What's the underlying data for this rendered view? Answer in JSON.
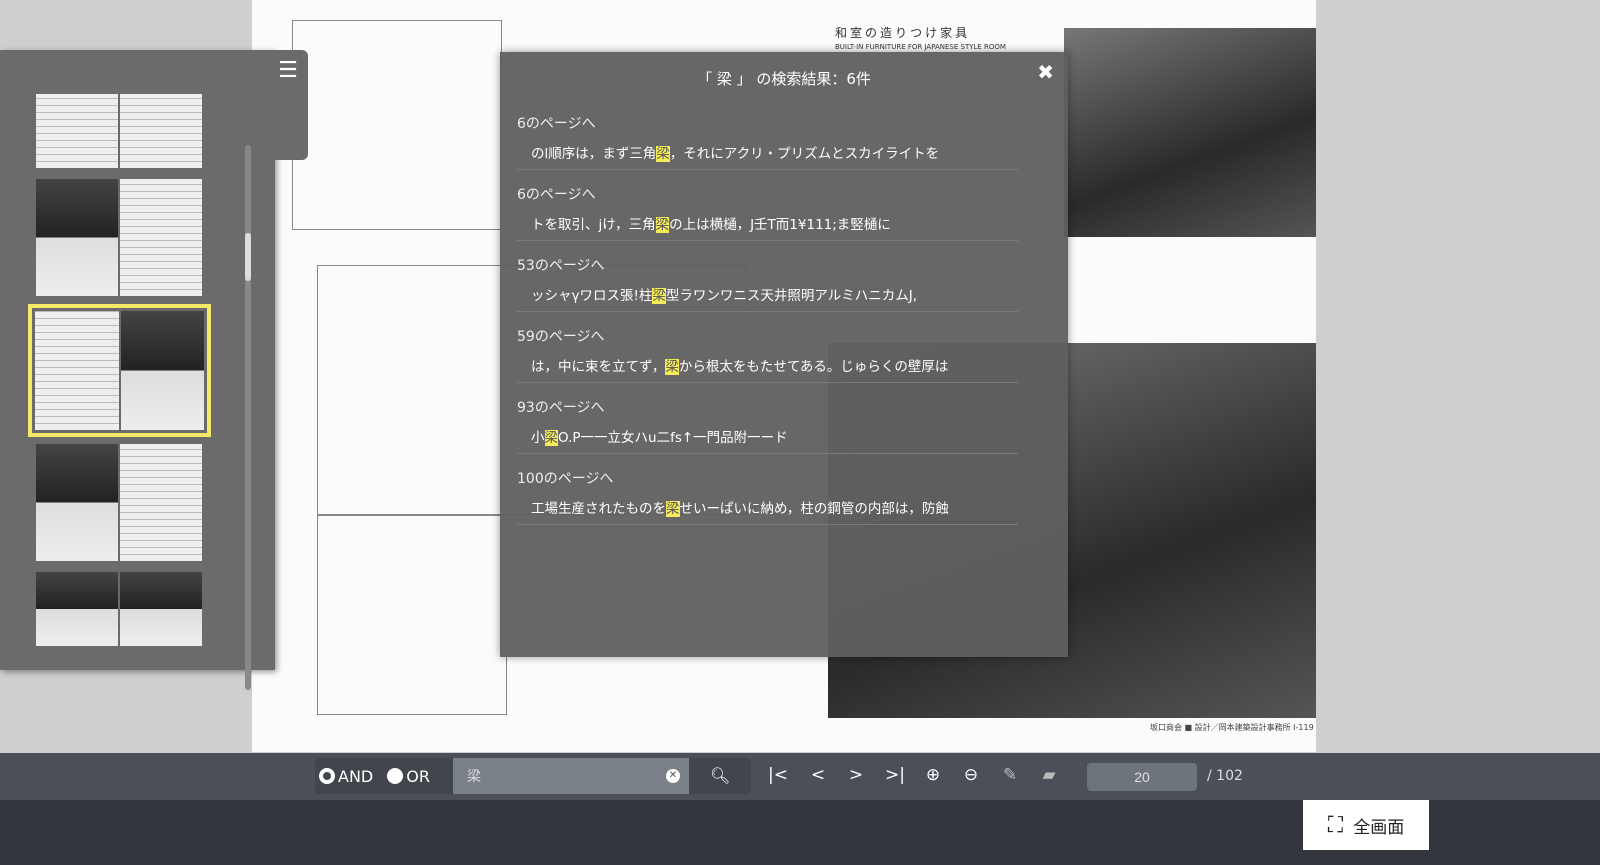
{
  "document": {
    "title_jp": "和室の造りつけ家具",
    "title_en": "BUILT-IN FURNITURE FOR JAPANESE STYLE ROOM",
    "footer": "坂口商会 ■ 設計／岡本建築設計事務所 I-119"
  },
  "thumbnails": [
    {
      "selected": false
    },
    {
      "selected": false
    },
    {
      "selected": true
    },
    {
      "selected": false
    },
    {
      "selected": false
    }
  ],
  "search_modal": {
    "title": "「 梁 」 の検索結果：6件",
    "close_icon": "close-icon",
    "results": [
      {
        "page": "6のページへ",
        "before": "のl順序は，まず三角",
        "hit": "梁",
        "after": "，それにアクリ・プリズムとスカイライトを"
      },
      {
        "page": "6のページへ",
        "before": "トを取引、jけ，三角",
        "hit": "梁",
        "after": "の上は横樋，J壬T而1¥111;ま竪樋に"
      },
      {
        "page": "53のページへ",
        "before": "ッシャγワロス張!柱",
        "hit": "梁",
        "after": "型ラワンワニス天井照明アルミハニカムJ,"
      },
      {
        "page": "59のページへ",
        "before": "は，中に束を立てず，",
        "hit": "梁",
        "after": "から根太をもたせてある。じゅらくの壁厚は"
      },
      {
        "page": "93のページへ",
        "before": "小",
        "hit": "梁",
        "after": "O.P一一立女ハu二fs↑一門品附一ード"
      },
      {
        "page": "100のページへ",
        "before": "工場生産されたものを",
        "hit": "梁",
        "after": "せいーぱいに納め，柱の鋼管の内部は，防蝕"
      }
    ],
    "highlight_color": "#f6ec5a"
  },
  "toolbar": {
    "and_label": "AND",
    "or_label": "OR",
    "selected_mode": "AND",
    "search_value": "梁",
    "current_page": "20",
    "total_pages": "/ 102",
    "fullscreen_label": "全画面"
  }
}
